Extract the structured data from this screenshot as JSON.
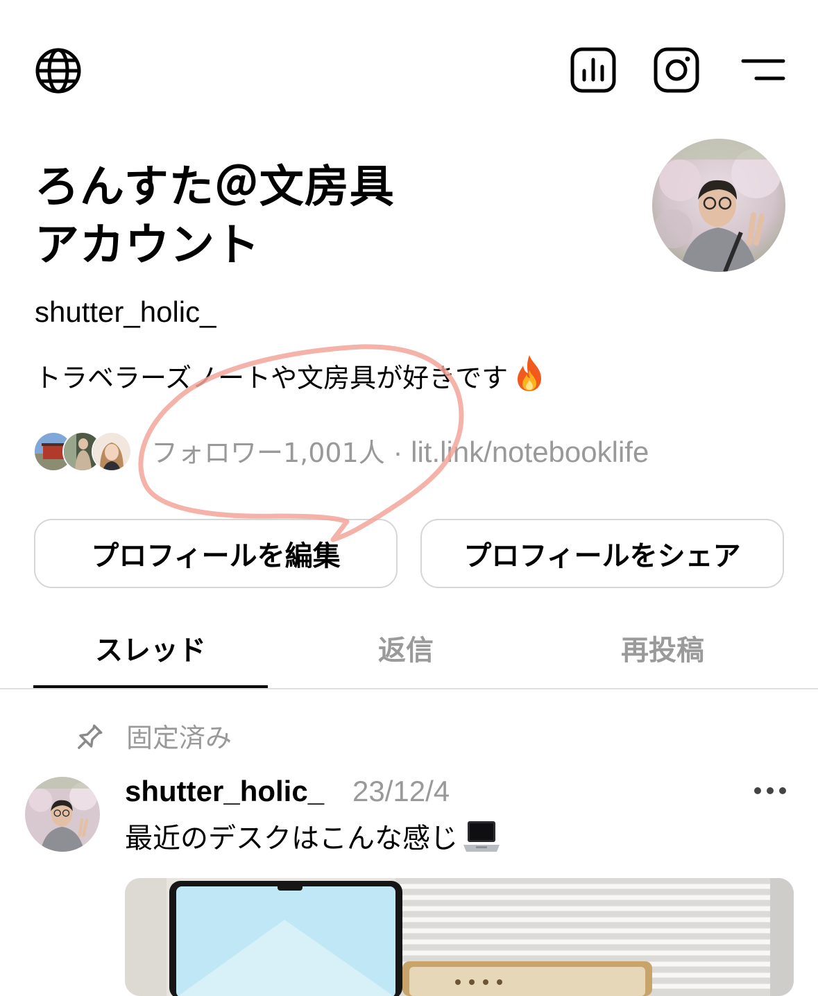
{
  "top_bar": {
    "icons": [
      "globe-icon",
      "insights-icon",
      "instagram-icon",
      "menu-icon"
    ]
  },
  "profile": {
    "display_name_line1": "ろんすた＠文房具",
    "display_name_line2": "アカウント",
    "username": "shutter_holic_",
    "bio": "トラベラーズノートや文房具が好きです",
    "bio_emoji": "fire-emoji",
    "followers_text": "フォロワー1,001人",
    "separator": " · ",
    "link": "lit.link/notebooklife"
  },
  "buttons": {
    "edit_label": "プロフィールを編集",
    "share_label": "プロフィールをシェア"
  },
  "tabs": [
    {
      "label": "スレッド",
      "active": true
    },
    {
      "label": "返信",
      "active": false
    },
    {
      "label": "再投稿",
      "active": false
    }
  ],
  "pinned": {
    "label": "固定済み"
  },
  "post": {
    "username": "shutter_holic_",
    "date": "23/12/4",
    "text": "最近のデスクはこんな感じ",
    "text_emoji": "laptop-emoji"
  },
  "colors": {
    "text": "#000000",
    "muted": "#999999",
    "border": "#d6d6d6",
    "annotation": "#f2a59a"
  }
}
